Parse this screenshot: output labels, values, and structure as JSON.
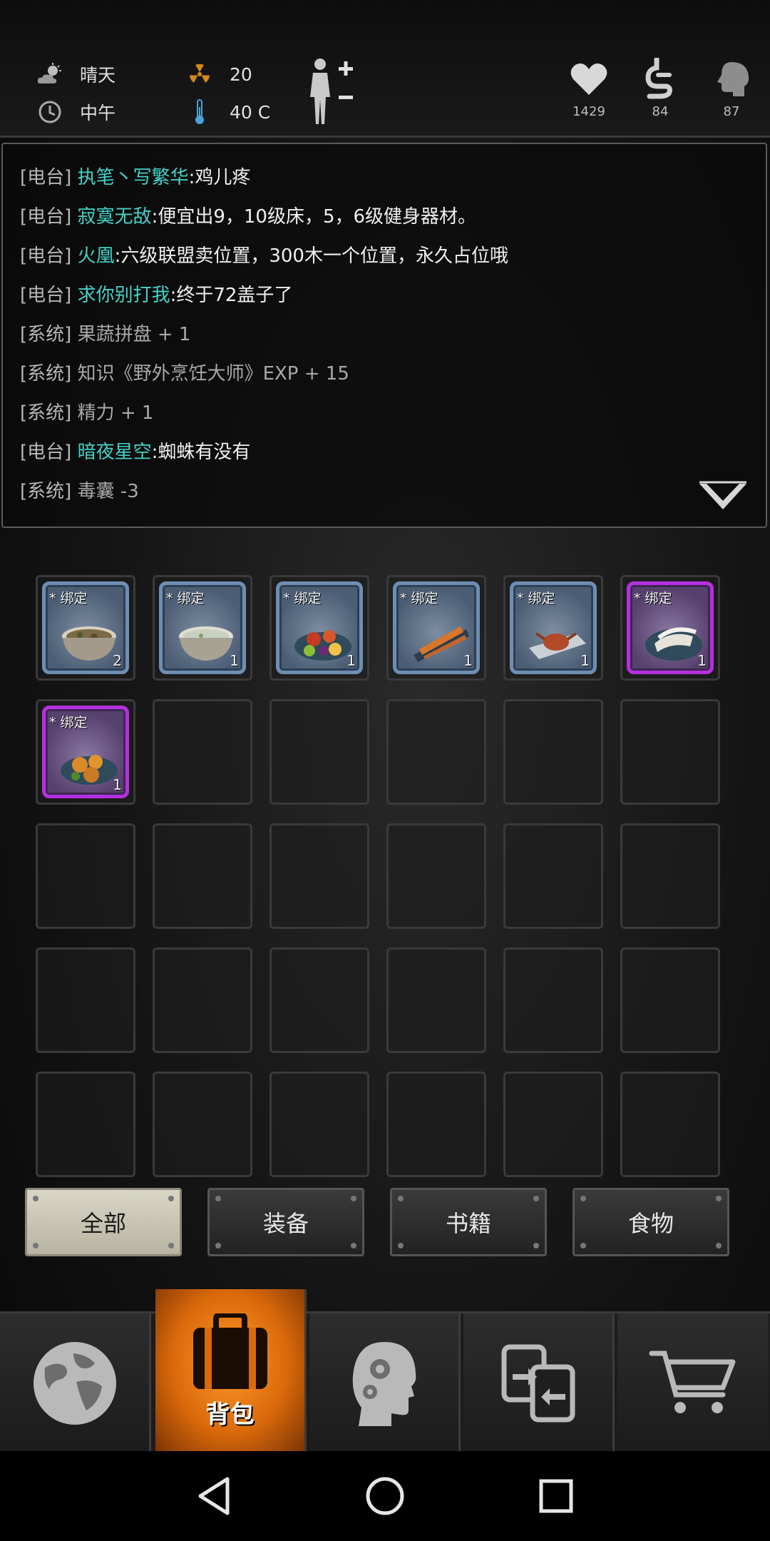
{
  "status": {
    "weather": "晴天",
    "radiation": "20",
    "time_of_day": "中午",
    "temperature": "40 C",
    "vitals": [
      {
        "name": "health",
        "icon": "heart-icon",
        "value": "1429"
      },
      {
        "name": "hunger",
        "icon": "stomach-icon",
        "value": "84"
      },
      {
        "name": "mind",
        "icon": "brain-icon",
        "value": "87"
      }
    ]
  },
  "log": [
    {
      "tag": "[电台]",
      "name": "执笔丶写繁华",
      "text": ":鸡儿疼"
    },
    {
      "tag": "[电台]",
      "name": "寂寞无敌",
      "text": ":便宜出9，10级床，5，6级健身器材。"
    },
    {
      "tag": "[电台]",
      "name": "火凰",
      "text": ":六级联盟卖位置，300木一个位置，永久占位哦"
    },
    {
      "tag": "[电台]",
      "name": "求你别打我",
      "text": ":终于72盖子了"
    },
    {
      "tag": "[系统]",
      "name": "",
      "text": "果蔬拼盘 + 1"
    },
    {
      "tag": "[系统]",
      "name": "",
      "text": "知识《野外烹饪大师》EXP + 15"
    },
    {
      "tag": "[系统]",
      "name": "",
      "text": "精力 + 1"
    },
    {
      "tag": "[电台]",
      "name": "暗夜星空",
      "text": ":蜘蛛有没有"
    },
    {
      "tag": "[系统]",
      "name": "",
      "text": "毒囊 -3"
    }
  ],
  "inventory": {
    "items": [
      {
        "bind": "* 绑定",
        "qty": "2",
        "rarity": "blue",
        "icon": "stew-bowl-icon"
      },
      {
        "bind": "* 绑定",
        "qty": "1",
        "rarity": "blue",
        "icon": "porridge-bowl-icon"
      },
      {
        "bind": "* 绑定",
        "qty": "1",
        "rarity": "blue",
        "icon": "fruit-veg-platter-icon"
      },
      {
        "bind": "* 绑定",
        "qty": "1",
        "rarity": "blue",
        "icon": "grilled-fish-skewers-icon"
      },
      {
        "bind": "* 绑定",
        "qty": "1",
        "rarity": "blue",
        "icon": "crab-dish-icon"
      },
      {
        "bind": "* 绑定",
        "qty": "1",
        "rarity": "purple",
        "icon": "sliced-meat-dish-icon"
      },
      {
        "bind": "* 绑定",
        "qty": "1",
        "rarity": "purple",
        "icon": "fried-chicken-dish-icon"
      }
    ],
    "total_slots": 30
  },
  "filters": [
    {
      "label": "全部",
      "active": true
    },
    {
      "label": "装备",
      "active": false
    },
    {
      "label": "书籍",
      "active": false
    },
    {
      "label": "食物",
      "active": false
    }
  ],
  "nav": {
    "tabs": [
      {
        "icon": "globe-icon",
        "label": ""
      },
      {
        "icon": "backpack-icon",
        "label": "背包",
        "active": true
      },
      {
        "icon": "head-gears-icon",
        "label": ""
      },
      {
        "icon": "trade-icon",
        "label": ""
      },
      {
        "icon": "shopping-cart-icon",
        "label": ""
      }
    ]
  },
  "colors": {
    "accent_orange": "#e8760f",
    "player_name": "#45d2c8",
    "rare_blue": "#6e8eb2",
    "epic_purple": "#b62fe0"
  }
}
